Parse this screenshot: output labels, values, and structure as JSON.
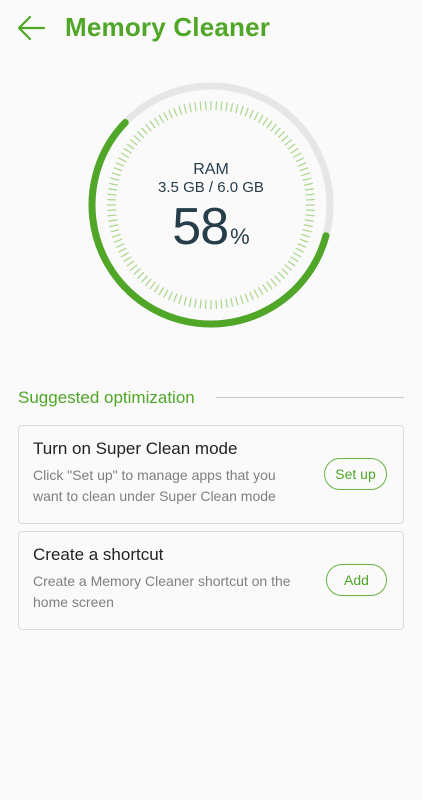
{
  "header": {
    "title": "Memory Cleaner",
    "back_icon": "arrow-left-icon"
  },
  "gauge": {
    "label": "RAM",
    "usage_text": "3.5 GB / 6.0 GB",
    "percent": "58",
    "percent_sign": "%",
    "fill_fraction": 0.58,
    "accent_color": "#4fa627",
    "track_color": "#e6e6e6"
  },
  "section": {
    "title": "Suggested optimization"
  },
  "cards": [
    {
      "title": "Turn on Super Clean mode",
      "description": "Click \"Set up\" to manage apps that you want to clean under Super Clean mode",
      "button_label": "Set up"
    },
    {
      "title": "Create a shortcut",
      "description": "Create a Memory Cleaner shortcut on the home screen",
      "button_label": "Add"
    }
  ]
}
